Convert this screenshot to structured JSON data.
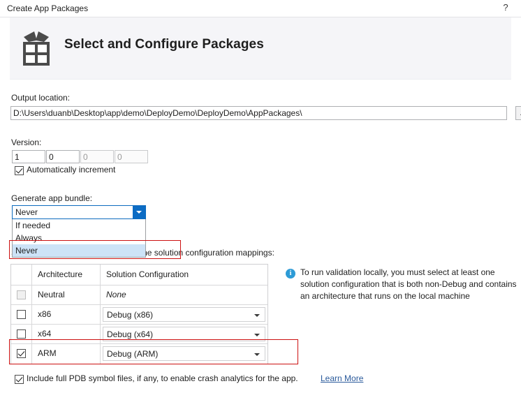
{
  "window": {
    "title": "Create App Packages",
    "help_icon": "question-mark-icon",
    "help_label": "?"
  },
  "banner": {
    "icon": "gift-box-icon",
    "title": "Select and Configure Packages"
  },
  "output": {
    "label": "Output location:",
    "value": "D:\\Users\\duanb\\Desktop\\app\\demo\\DeployDemo\\DeployDemo\\AppPackages\\",
    "browse_label": "..."
  },
  "version": {
    "label": "Version:",
    "major": "1",
    "minor": "0",
    "build": "0",
    "revision": "0",
    "separator": ".",
    "auto_increment_label": "Automatically increment",
    "auto_increment_checked": true
  },
  "bundle": {
    "label": "Generate app bundle:",
    "selected": "Never",
    "options": [
      "If needed",
      "Always",
      "Never"
    ],
    "highlighted": "Never",
    "expanded": true,
    "arrow_icon": "chevron-down-icon"
  },
  "packages": {
    "caption": "Select the packages to create and the solution configuration mappings:",
    "columns": [
      "",
      "Architecture",
      "Solution Configuration"
    ],
    "rows": [
      {
        "checked": false,
        "disabled": true,
        "architecture": "Neutral",
        "configuration": "None",
        "has_combo": false
      },
      {
        "checked": false,
        "disabled": false,
        "architecture": "x86",
        "configuration": "Debug (x86)",
        "has_combo": true
      },
      {
        "checked": false,
        "disabled": false,
        "architecture": "x64",
        "configuration": "Debug (x64)",
        "has_combo": true
      },
      {
        "checked": true,
        "disabled": false,
        "architecture": "ARM",
        "configuration": "Debug (ARM)",
        "has_combo": true
      }
    ]
  },
  "info": {
    "icon": "info-circle-icon",
    "icon_glyph": "i",
    "text": "To run validation locally, you must select at least one solution configuration that is both non-Debug and contains an architecture that runs on the local machine"
  },
  "pdb": {
    "checked": true,
    "label": "Include full PDB symbol files, if any, to enable crash analytics for the app.",
    "link_label": "Learn More"
  },
  "annotations": {
    "accent_color": "#cc1111",
    "boxes": [
      "bundle-never-option",
      "arm-row"
    ]
  }
}
